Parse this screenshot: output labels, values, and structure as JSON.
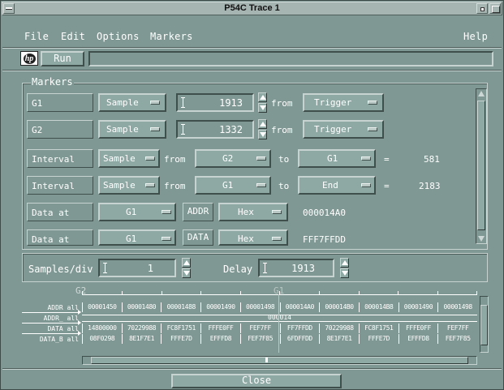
{
  "window": {
    "title": "P54C Trace 1"
  },
  "menubar": {
    "file": "File",
    "edit": "Edit",
    "options": "Options",
    "markers": "Markers",
    "help": "Help"
  },
  "toolbar": {
    "run": "Run",
    "status": ""
  },
  "markers": {
    "group_label": "Markers",
    "rows": [
      {
        "name": "G1",
        "mode": "Sample",
        "value": "1913",
        "from": "from",
        "ref": "Trigger"
      },
      {
        "name": "G2",
        "mode": "Sample",
        "value": "1332",
        "from": "from",
        "ref": "Trigger"
      },
      {
        "name": "Interval",
        "mode": "Sample",
        "from": "from",
        "start": "G2",
        "to": "to",
        "end": "G1",
        "eq": "=",
        "result": "581"
      },
      {
        "name": "Interval",
        "mode": "Sample",
        "from": "from",
        "start": "G1",
        "to": "to",
        "end": "End",
        "eq": "=",
        "result": "2183"
      },
      {
        "name": "Data at",
        "marker": "G1",
        "field": "ADDR",
        "base": "Hex",
        "result": "000014A0"
      },
      {
        "name": "Data at",
        "marker": "G1",
        "field": "DATA",
        "base": "Hex",
        "result": "FFF7FFDD"
      }
    ]
  },
  "samples": {
    "label": "Samples/div",
    "value": "1",
    "delay_label": "Delay",
    "delay_value": "1913"
  },
  "waveform": {
    "cursor_g2": "G2",
    "cursor_g1": "G1",
    "rows": [
      {
        "label": "ADDR all",
        "cells": [
          "00001450",
          "00001480",
          "00001488",
          "00001490",
          "00001498",
          "000014A0",
          "000014B0",
          "000014B8",
          "00001490",
          "00001498"
        ]
      },
      {
        "label": "ADDR_ all",
        "center": "000014"
      },
      {
        "label": "DATA all",
        "cells": [
          "14800000",
          "70229988",
          "FC8F1751",
          "FFFE0FF",
          "FEF7FF",
          "FF7FFDD",
          "70229988",
          "FC8F1751",
          "FFFE0FF",
          "FEF7FF"
        ]
      },
      {
        "label": "DATA_B all",
        "cells": [
          "08F0298",
          "8E1F7E1",
          "FFFE7D",
          "EFFFD8",
          "FEF7F85",
          "6FDFFDD",
          "8E1F7E1",
          "FFFE7D",
          "EFFFD8",
          "FEF7F85"
        ]
      }
    ]
  },
  "footer": {
    "close": "Close"
  }
}
